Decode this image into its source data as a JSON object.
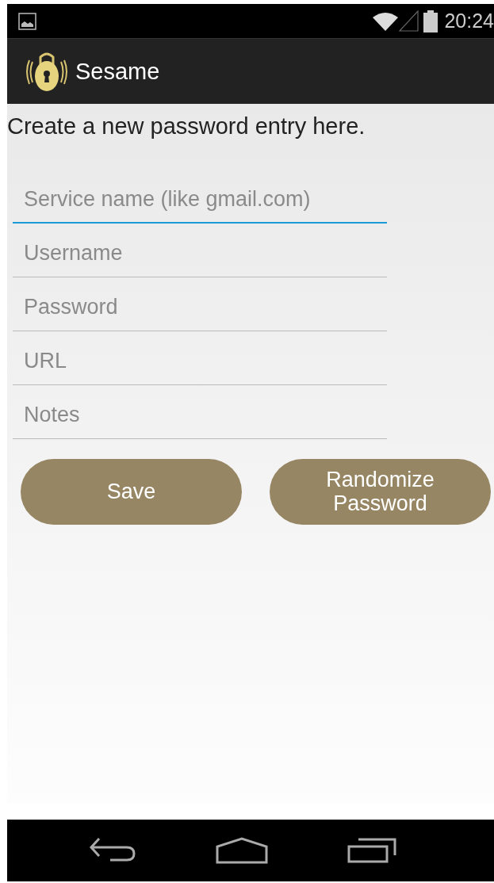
{
  "status_bar": {
    "time": "20:24"
  },
  "action_bar": {
    "title": "Sesame"
  },
  "intro": "Create a new password entry here.",
  "fields": [
    {
      "placeholder": "Service name (like gmail.com)",
      "focused": true
    },
    {
      "placeholder": "Username",
      "focused": false
    },
    {
      "placeholder": "Password",
      "focused": false
    },
    {
      "placeholder": "URL",
      "focused": false
    },
    {
      "placeholder": "Notes",
      "focused": false
    }
  ],
  "buttons": [
    {
      "label": "Save"
    },
    {
      "label": "Randomize Password"
    }
  ]
}
